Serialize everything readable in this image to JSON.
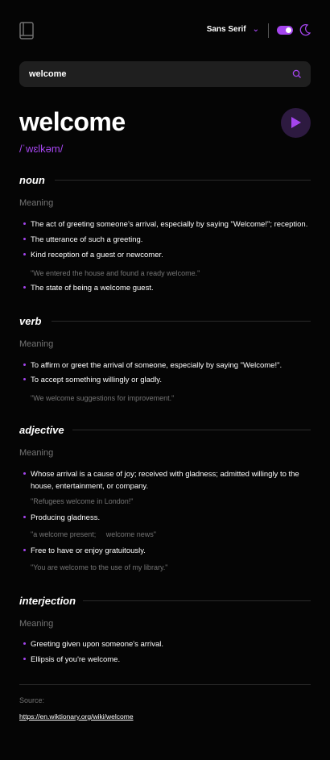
{
  "header": {
    "font_selected": "Sans Serif"
  },
  "search": {
    "value": "welcome"
  },
  "entry": {
    "word": "welcome",
    "phonetic": "/ˈwɛlkəm/",
    "meaning_label": "Meaning",
    "meanings": [
      {
        "pos": "noun",
        "definitions": [
          {
            "text": "The act of greeting someone’s arrival, especially by saying \"Welcome!\"; reception."
          },
          {
            "text": "The utterance of such a greeting."
          },
          {
            "text": "Kind reception of a guest or newcomer.",
            "example": "\"We entered the house and found a ready welcome.\""
          },
          {
            "text": "The state of being a welcome guest."
          }
        ]
      },
      {
        "pos": "verb",
        "definitions": [
          {
            "text": "To affirm or greet the arrival of someone, especially by saying \"Welcome!\"."
          },
          {
            "text": "To accept something willingly or gladly.",
            "example": "\"We welcome suggestions for improvement.\""
          }
        ]
      },
      {
        "pos": "adjective",
        "definitions": [
          {
            "text": "Whose arrival is a cause of joy; received with gladness; admitted willingly to the house, entertainment, or company.",
            "example": "\"Refugees welcome in London!\""
          },
          {
            "text": "Producing gladness.",
            "example": "\"a welcome present;     welcome news\""
          },
          {
            "text": "Free to have or enjoy gratuitously.",
            "example": "\"You are welcome to the use of my library.\""
          }
        ]
      },
      {
        "pos": "interjection",
        "definitions": [
          {
            "text": "Greeting given upon someone's arrival."
          },
          {
            "text": "Ellipsis of you're welcome."
          }
        ]
      }
    ]
  },
  "source": {
    "label": "Source:",
    "url": "https://en.wiktionary.org/wiki/welcome"
  },
  "colors": {
    "accent": "#a445ed",
    "background": "#050505",
    "muted": "#757575"
  },
  "icons": [
    "book-icon",
    "chevron-down-icon",
    "theme-toggle",
    "moon-icon",
    "search-icon",
    "play-icon"
  ]
}
